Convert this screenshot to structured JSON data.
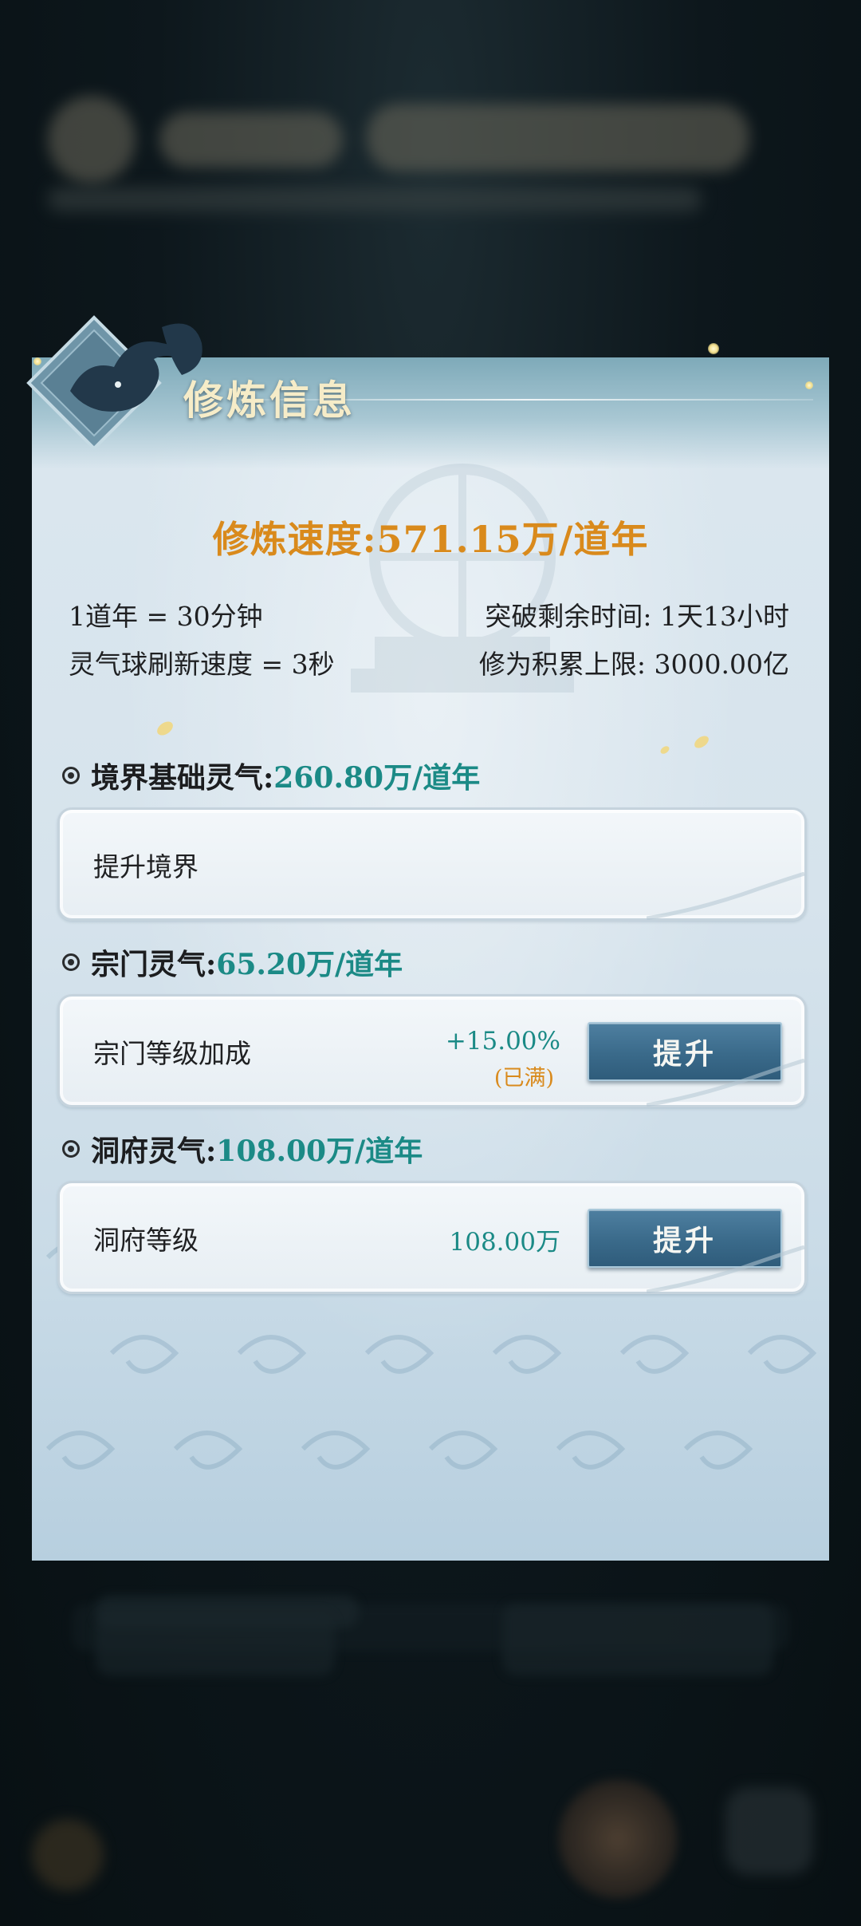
{
  "panel": {
    "title": "修炼信息"
  },
  "speed": {
    "text": "修炼速度:571.15万/道年"
  },
  "info": {
    "dao_year": "1道年 = 30分钟",
    "breakthrough_remaining": "突破剩余时间: 1天13小时",
    "orb_refresh": "灵气球刷新速度 = 3秒",
    "accumulation_cap": "修为积累上限: 3000.00亿"
  },
  "sections": [
    {
      "label": "境界基础灵气:",
      "value": "260.80万/道年",
      "card": {
        "label": "提升境界"
      }
    },
    {
      "label": "宗门灵气:",
      "value": "65.20万/道年",
      "card": {
        "label": "宗门等级加成",
        "value": "+15.00%",
        "sub": "(已满)",
        "button": "提升"
      }
    },
    {
      "label": "洞府灵气:",
      "value": "108.00万/道年",
      "card": {
        "label": "洞府等级",
        "value": "108.00万",
        "button": "提升"
      }
    }
  ],
  "colors": {
    "accent_orange": "#d98a1c",
    "accent_teal": "#1b8a86",
    "button_blue": "#3a6a8a",
    "title_cream": "#f6ecc8"
  },
  "icons": {
    "emblem": "fox-spirit-emblem-icon",
    "bullet": "radio-dot-icon"
  }
}
